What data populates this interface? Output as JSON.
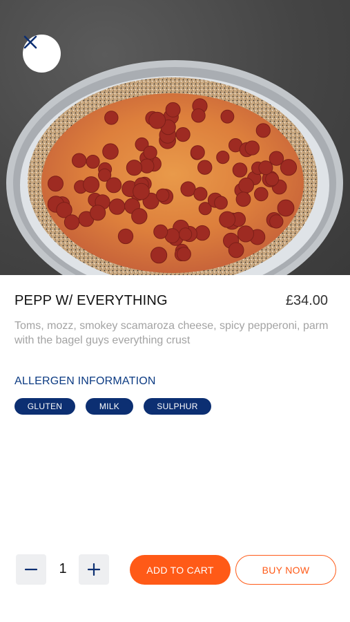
{
  "hero": {
    "image_description_icon": "pizza-image"
  },
  "close_icon": "close-icon",
  "product": {
    "title": "PEPP W/ EVERYTHING",
    "price": "£34.00",
    "description": "Toms, mozz, smokey scamaroza cheese, spicy pepperoni, parm with the bagel guys everything crust"
  },
  "allergens": {
    "title": "ALLERGEN INFORMATION",
    "items": [
      "GLUTEN",
      "MILK",
      "SULPHUR"
    ]
  },
  "quantity": {
    "value": "1",
    "minus_icon": "minus-icon",
    "plus_icon": "plus-icon"
  },
  "actions": {
    "add_to_cart": "ADD TO CART",
    "buy_now": "BUY NOW"
  },
  "colors": {
    "accent": "#ff5a17",
    "navy": "#0c2f72",
    "allergen_title": "#0b3a82"
  }
}
